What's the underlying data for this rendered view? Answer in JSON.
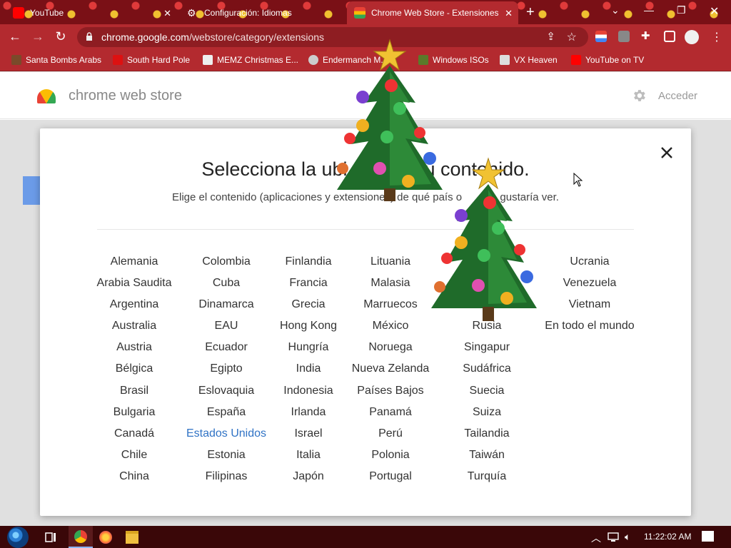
{
  "browser": {
    "tabs": [
      {
        "title": "YouTube",
        "favicon_color": "#ff0000"
      },
      {
        "title": "Configuración: Idiomas",
        "favicon_color": "#ffffff"
      },
      {
        "title": "Chrome Web Store - Extensiones",
        "favicon_color": "#4285f4",
        "active": true
      }
    ],
    "url_host": "chrome.google.com",
    "url_path": "/webstore/category/extensions",
    "bookmarks": [
      {
        "label": "Santa Bombs Arabs"
      },
      {
        "label": "South Hard Pole"
      },
      {
        "label": "MEMZ Christmas E..."
      },
      {
        "label": "Endermanch M..."
      },
      {
        "label": "Windows ISOs"
      },
      {
        "label": "VX Heaven"
      },
      {
        "label": "YouTube on TV"
      }
    ]
  },
  "store": {
    "title": "chrome web store",
    "signin": "Acceder"
  },
  "dialog": {
    "title": "Selecciona la ubi    u contenido.",
    "subtitle": "Elige el contenido (aplicaciones y extensiones) de qué país o     gustaría ver.",
    "selected": "Estados Unidos",
    "columns": [
      [
        "Alemania",
        "Arabia Saudita",
        "Argentina",
        "Australia",
        "Austria",
        "Bélgica",
        "Brasil",
        "Bulgaria",
        "Canadá",
        "Chile",
        "China"
      ],
      [
        "Colombia",
        "Cuba",
        "Dinamarca",
        "EAU",
        "Ecuador",
        "Egipto",
        "Eslovaquia",
        "España",
        "Estados Unidos",
        "Estonia",
        "Filipinas"
      ],
      [
        "Finlandia",
        "Francia",
        "Grecia",
        "Hong Kong",
        "Hungría",
        "India",
        "Indonesia",
        "Irlanda",
        "Israel",
        "Italia",
        "Japón"
      ],
      [
        "Lituania",
        "Malasia",
        "Marruecos",
        "México",
        "Noruega",
        "Nueva Zelanda",
        "Países Bajos",
        "Panamá",
        "Perú",
        "Polonia",
        "Portugal"
      ],
      [
        "",
        "",
        "",
        "Rusia",
        "Singapur",
        "Sudáfrica",
        "Suecia",
        "Suiza",
        "Tailandia",
        "Taiwán",
        "Turquía"
      ],
      [
        "Ucrania",
        "Venezuela",
        "Vietnam",
        "En todo el mundo"
      ]
    ]
  },
  "taskbar": {
    "clock": "11:22:02 AM"
  }
}
